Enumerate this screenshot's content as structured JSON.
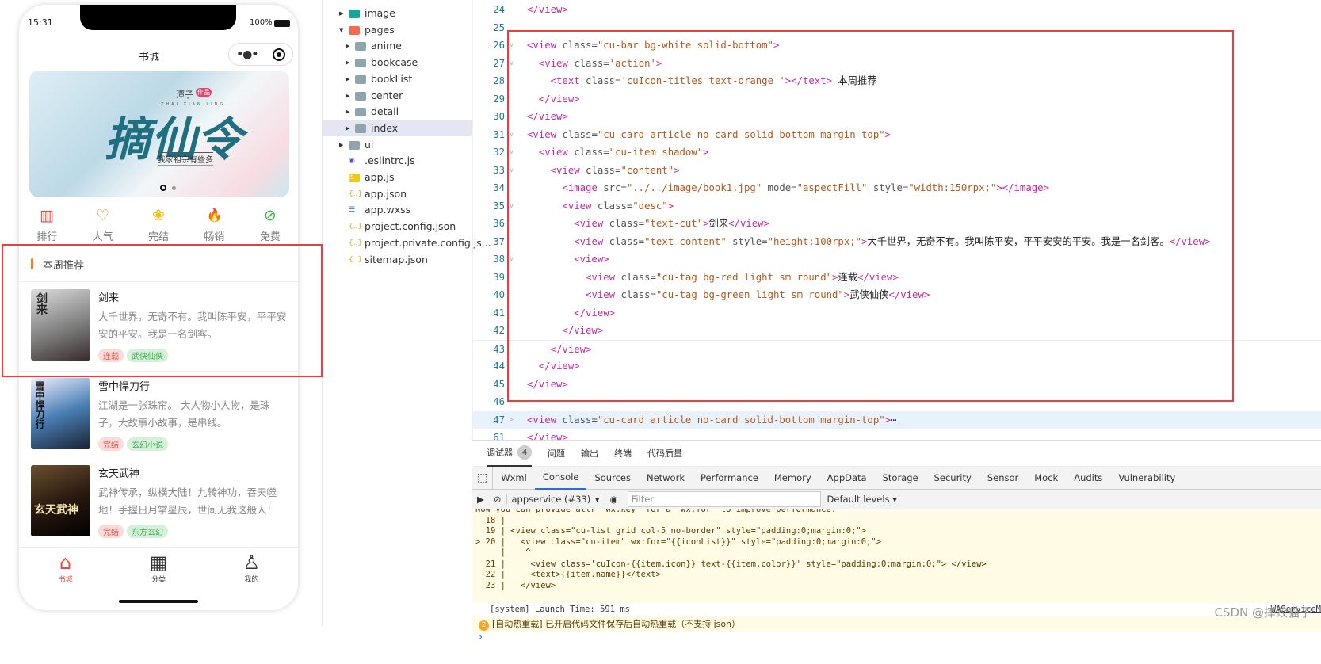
{
  "colors": {
    "accent": "#f37b1d",
    "highlight_box": "#f03c3c",
    "tag_red": "#e54d42",
    "tag_green": "#39b54a",
    "console_tab_underline": "#1a73e8"
  },
  "phone": {
    "time": "15:31",
    "battery": "100%",
    "title": "书城",
    "capsule": {
      "more_icon": "more-dots-icon",
      "close_icon": "target-circle-icon"
    },
    "banner": {
      "author": "潭子",
      "badge": "作品",
      "title": "摘仙令",
      "pinyin": "ZHAI XIAN LING",
      "subtitle": "我家祖宗有些多",
      "dots": 2,
      "active_dot": 1
    },
    "grid": [
      {
        "label": "排行",
        "icon": "bar-chart-icon",
        "color": "#e54d42",
        "glyph": "▥"
      },
      {
        "label": "人气",
        "icon": "heart-icon",
        "color": "#f37b1d",
        "glyph": "♡"
      },
      {
        "label": "完结",
        "icon": "tulip-icon",
        "color": "#fbbd08",
        "glyph": "❀"
      },
      {
        "label": "畅销",
        "icon": "fire-icon",
        "color": "#8dc63f",
        "glyph": "🔥"
      },
      {
        "label": "免费",
        "icon": "link-circle-icon",
        "color": "#39b54a",
        "glyph": "⊘"
      }
    ],
    "section_title": "本周推荐",
    "books": [
      {
        "title": "剑来",
        "content": "大千世界，无奇不有。我叫陈平安，平平安安的平安。我是一名剑客。",
        "tags": [
          {
            "label": "连载",
            "color": "red"
          },
          {
            "label": "武侠仙侠",
            "color": "green"
          }
        ],
        "cover_text": "剑来"
      },
      {
        "title": "雪中悍刀行",
        "content": "江湖是一张珠帘。 大人物小人物，是珠子，大故事小故事，是串线。",
        "tags": [
          {
            "label": "完结",
            "color": "red"
          },
          {
            "label": "玄幻小说",
            "color": "green"
          }
        ],
        "cover_text": "雪中悍刀行"
      },
      {
        "title": "玄天武神",
        "content": "武神传承，纵横大陆！九转神功，吞天噬地！手握日月掌星辰，世间无我这般人！",
        "tags": [
          {
            "label": "完结",
            "color": "red"
          },
          {
            "label": "东方玄幻",
            "color": "green"
          }
        ],
        "cover_text": "玄天武神"
      }
    ],
    "tabbar": [
      {
        "label": "书城",
        "icon": "home-icon",
        "active": true
      },
      {
        "label": "分类",
        "icon": "grid-icon",
        "active": false
      },
      {
        "label": "我的",
        "icon": "user-icon",
        "active": false
      }
    ]
  },
  "file_tree": [
    {
      "name": "image",
      "type": "folder-image",
      "depth": 0,
      "expanded": false
    },
    {
      "name": "pages",
      "type": "folder-pages",
      "depth": 0,
      "expanded": true
    },
    {
      "name": "anime",
      "type": "folder",
      "depth": 1,
      "expanded": false
    },
    {
      "name": "bookcase",
      "type": "folder",
      "depth": 1,
      "expanded": false
    },
    {
      "name": "bookList",
      "type": "folder",
      "depth": 1,
      "expanded": false
    },
    {
      "name": "center",
      "type": "folder",
      "depth": 1,
      "expanded": false
    },
    {
      "name": "detail",
      "type": "folder",
      "depth": 1,
      "expanded": false
    },
    {
      "name": "index",
      "type": "folder",
      "depth": 1,
      "expanded": false,
      "selected": true
    },
    {
      "name": "ui",
      "type": "folder",
      "depth": 0,
      "expanded": false
    },
    {
      "name": ".eslintrc.js",
      "type": "eslint",
      "depth": 0
    },
    {
      "name": "app.js",
      "type": "js",
      "depth": 0
    },
    {
      "name": "app.json",
      "type": "json",
      "depth": 0
    },
    {
      "name": "app.wxss",
      "type": "css",
      "depth": 0
    },
    {
      "name": "project.config.json",
      "type": "json",
      "depth": 0
    },
    {
      "name": "project.private.config.js...",
      "type": "json",
      "depth": 0
    },
    {
      "name": "sitemap.json",
      "type": "json",
      "depth": 0
    }
  ],
  "editor": {
    "lines": [
      {
        "no": "24",
        "text": "</view>",
        "fold": ""
      },
      {
        "no": "25",
        "text": "",
        "fold": ""
      },
      {
        "no": "26",
        "text": "<view class=\"cu-bar bg-white solid-bottom\">",
        "fold": "v"
      },
      {
        "no": "27",
        "text": "  <view class='action'>",
        "fold": "v"
      },
      {
        "no": "28",
        "text": "    <text class='cuIcon-titles text-orange '></text> 本周推荐",
        "fold": ""
      },
      {
        "no": "29",
        "text": "  </view>",
        "fold": ""
      },
      {
        "no": "30",
        "text": "</view>",
        "fold": ""
      },
      {
        "no": "31",
        "text": "<view class=\"cu-card article no-card solid-bottom margin-top\">",
        "fold": "v"
      },
      {
        "no": "32",
        "text": "  <view class=\"cu-item shadow\">",
        "fold": "v"
      },
      {
        "no": "33",
        "text": "    <view class=\"content\">",
        "fold": "v"
      },
      {
        "no": "34",
        "text": "      <image src=\"../../image/book1.jpg\" mode=\"aspectFill\" style=\"width:150rpx;\"></image>",
        "fold": ""
      },
      {
        "no": "35",
        "text": "      <view class=\"desc\">",
        "fold": "v"
      },
      {
        "no": "36",
        "text": "        <view class=\"text-cut\">剑来</view>",
        "fold": ""
      },
      {
        "no": "37",
        "text": "        <view class=\"text-content\" style=\"height:100rpx;\">大千世界，无奇不有。我叫陈平安，平平安安的平安。我是一名剑客。</view>",
        "fold": ""
      },
      {
        "no": "38",
        "text": "        <view>",
        "fold": "v"
      },
      {
        "no": "39",
        "text": "          <view class=\"cu-tag bg-red light sm round\">连载</view>",
        "fold": ""
      },
      {
        "no": "40",
        "text": "          <view class=\"cu-tag bg-green light sm round\">武侠仙侠</view>",
        "fold": ""
      },
      {
        "no": "41",
        "text": "        </view>",
        "fold": ""
      },
      {
        "no": "42",
        "text": "      </view>",
        "fold": ""
      },
      {
        "no": "43",
        "text": "    </view>",
        "fold": ""
      },
      {
        "no": "44",
        "text": "  </view>",
        "fold": ""
      },
      {
        "no": "45",
        "text": "</view>",
        "fold": ""
      },
      {
        "no": "46",
        "text": "",
        "fold": ""
      },
      {
        "no": "47",
        "text": "<view class=\"cu-card article no-card solid-bottom margin-top\">⋯",
        "fold": ">"
      },
      {
        "no": "61",
        "text": "</view>",
        "fold": ""
      }
    ]
  },
  "devtools": {
    "top_tabs": [
      "调试器",
      "问题",
      "输出",
      "终端",
      "代码质量"
    ],
    "debugger_badge": "4",
    "panel_tabs": [
      "Wxml",
      "Console",
      "Sources",
      "Network",
      "Performance",
      "Memory",
      "AppData",
      "Storage",
      "Security",
      "Sensor",
      "Mock",
      "Audits",
      "Vulnerability"
    ],
    "active_panel": "Console",
    "context": "appservice (#33)",
    "filter_placeholder": "Filter",
    "levels": "Default levels ▾",
    "warning_lines": [
      "Now you can provide attr \"wx:key\" for a \"wx:for\" to improve performance.",
      "  18 |",
      "  19 | <view class=\"cu-list grid col-5 no-border\" style=\"padding:0;margin:0;\">",
      "> 20 |   <view class=\"cu-item\" wx:for=\"{{iconList}}\" style=\"padding:0;margin:0;\">",
      "     |    ^",
      "  21 |     <view class='cuIcon-{{item.icon}} text-{{item.color}}' style=\"padding:0;margin:0;\"> </view>",
      "  22 |     <text>{{item.name}}</text>",
      "  23 |   </view>"
    ],
    "system_line": "[system] Launch Time: 591 ms",
    "system_source": "WAServiceM",
    "hot_reload_count": "2",
    "hot_reload": "[自动热重载] 已开启代码文件保存后自动热重载（不支持 json）",
    "prompt": "›"
  },
  "watermark": "CSDN @摔跤猫子"
}
